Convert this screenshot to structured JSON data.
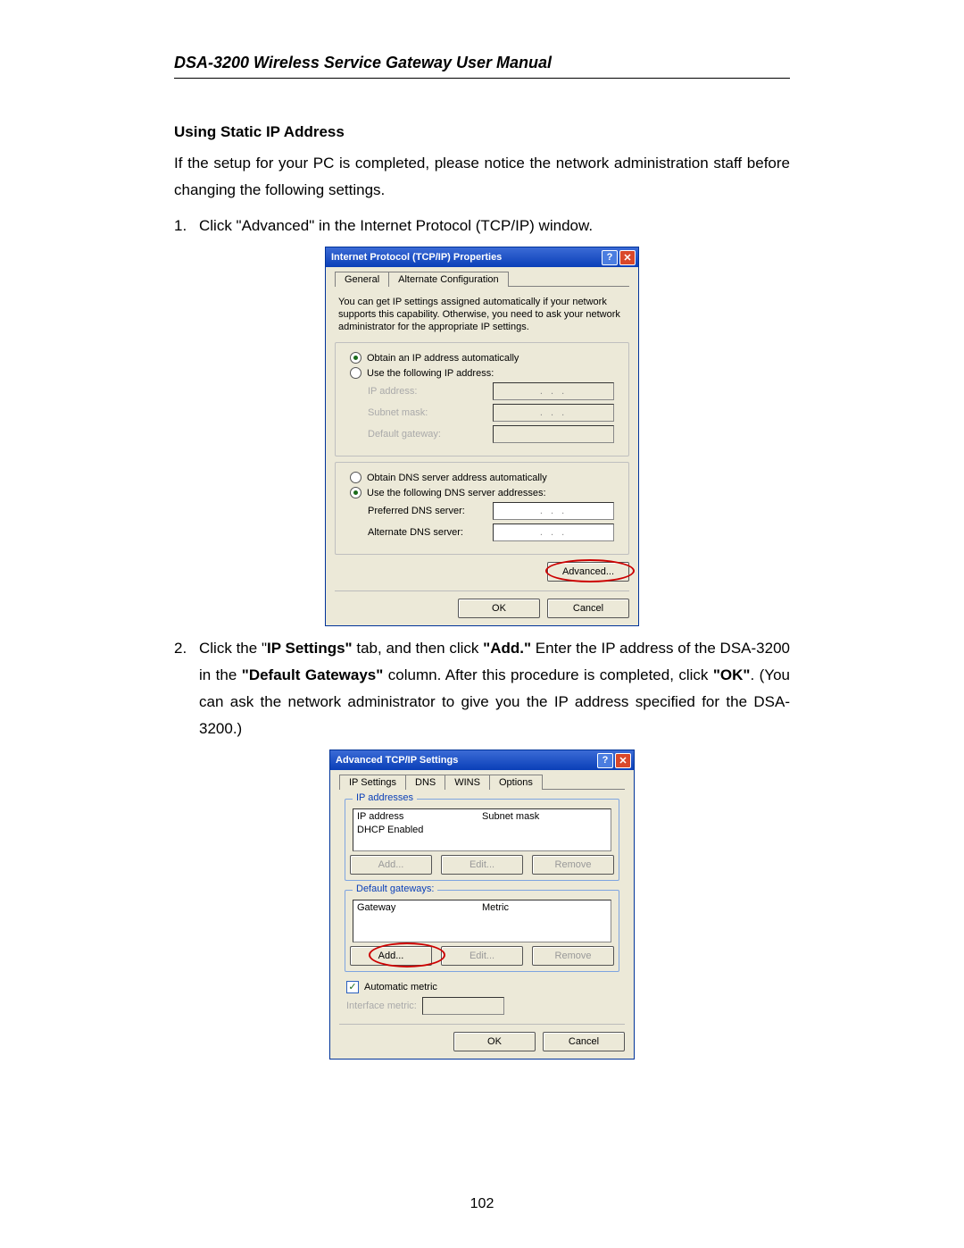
{
  "header": {
    "title": "DSA-3200 Wireless Service Gateway User Manual"
  },
  "section": {
    "heading": "Using Static IP Address"
  },
  "intro": "If the setup for your PC is completed, please notice the network administration staff before changing the following settings.",
  "steps": {
    "1": {
      "num": "1.",
      "text": "Click \"Advanced\" in the Internet Protocol (TCP/IP) window."
    },
    "2": {
      "num": "2.",
      "pre": "Click the \"",
      "b1": "IP Settings\"",
      "mid1": " tab, and then click ",
      "b2": "\"Add.\"",
      "mid2": " Enter the IP address of the DSA-3200 in the ",
      "b3": "\"Default Gateways\"",
      "mid3": " column. After this procedure is completed, click ",
      "b4": "\"OK\"",
      "post": ".   (You can ask the network administrator to give you the IP address specified for the DSA-3200.)"
    }
  },
  "dlg1": {
    "title": "Internet Protocol (TCP/IP) Properties",
    "tabs": {
      "general": "General",
      "alt": "Alternate Configuration"
    },
    "help": "You can get IP settings assigned automatically if your network supports this capability. Otherwise, you need to ask your network administrator for the appropriate IP settings.",
    "r1": "Obtain an IP address automatically",
    "r2": "Use the following IP address:",
    "ipaddr": "IP address:",
    "subnet": "Subnet mask:",
    "gateway": "Default gateway:",
    "r3": "Obtain DNS server address automatically",
    "r4": "Use the following DNS server addresses:",
    "pdns": "Preferred DNS server:",
    "adns": "Alternate DNS server:",
    "adv": "Advanced...",
    "ok": "OK",
    "cancel": "Cancel",
    "dots": ".   .   ."
  },
  "dlg2": {
    "title": "Advanced TCP/IP Settings",
    "tabs": {
      "ip": "IP Settings",
      "dns": "DNS",
      "wins": "WINS",
      "opt": "Options"
    },
    "fs1": {
      "legend": "IP addresses",
      "h1": "IP address",
      "h2": "Subnet mask",
      "row1": "DHCP Enabled"
    },
    "fs2": {
      "legend": "Default gateways:",
      "h1": "Gateway",
      "h2": "Metric"
    },
    "add": "Add...",
    "edit": "Edit...",
    "remove": "Remove",
    "auto": "Automatic metric",
    "ifm": "Interface metric:",
    "ok": "OK",
    "cancel": "Cancel"
  },
  "page_num": "102",
  "icons": {
    "help": "?",
    "close": "✕",
    "check": "✓"
  }
}
